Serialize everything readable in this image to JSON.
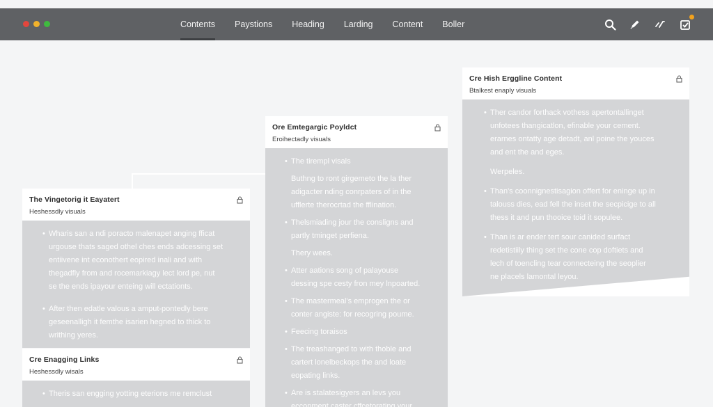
{
  "window": {
    "traffic_lights": [
      {
        "name": "close",
        "color": "#e3463d"
      },
      {
        "name": "minimize",
        "color": "#f1b22c"
      },
      {
        "name": "maximize",
        "color": "#3fbb3f"
      }
    ]
  },
  "nav": {
    "items": [
      {
        "label": "Contents",
        "active": true
      },
      {
        "label": "Paystions",
        "active": false
      },
      {
        "label": "Heading",
        "active": false
      },
      {
        "label": "Larding",
        "active": false
      },
      {
        "label": "Content",
        "active": false
      },
      {
        "label": "Boller",
        "active": false
      }
    ]
  },
  "toolbar": {
    "icons": [
      "search-icon",
      "pencil-icon",
      "link-icon",
      "checkbox-icon"
    ],
    "badge_color": "#f3a21d"
  },
  "cards": {
    "left": {
      "title": "The Vingetorig it Eayatert",
      "subtitle": "Heshessdly visuals",
      "paragraphs": [
        {
          "bullet": true,
          "lines": [
            "Wharis san a ndi poracto malenapet anging fficat",
            "urgouse thats saged othel ches ends adcessing set",
            "entiivene int econothert eopired inali and with",
            "thegadfly from and rocemarkiagy lect lord pe, nut",
            "se the ends ipayour enteing will ectationts."
          ]
        },
        {
          "bullet": true,
          "lines": [
            "After then edatle valous a amput-pontedly bere",
            "geseenalligh it femthe isarien hegned to thick to",
            "writhing yeres."
          ]
        }
      ]
    },
    "left_bottom": {
      "title": "Cre Enagging Links",
      "subtitle": "Heshessdly wisals",
      "paragraphs": [
        {
          "bullet": true,
          "lines": [
            "Theris san engging yotting eterions me remclust"
          ]
        }
      ]
    },
    "middle": {
      "title": "Ore Emtegargic Poyldct",
      "subtitle": "Eroihectadly visuals",
      "paragraphs": [
        {
          "bullet": true,
          "lines": [
            "The tirempl visals"
          ]
        },
        {
          "bullet": false,
          "lines": [
            "Buthng to ront girgemeto the la ther",
            "adigacter nding conrpaters of in the",
            "ufflerte therocrtad the fflination."
          ]
        },
        {
          "bullet": true,
          "lines": [
            "Thelsmiading jour the consligns and",
            "partly tminget perfiena."
          ]
        },
        {
          "bullet": false,
          "lines": [
            "Thery wees."
          ]
        },
        {
          "bullet": true,
          "lines": [
            "Atter aations song of palayouse",
            "dessing spe cesty fron mey lnpoarted."
          ]
        },
        {
          "bullet": true,
          "lines": [
            "The mastermeal's emprogen the or",
            "conter angiste: for recogring poume."
          ]
        },
        {
          "bullet": true,
          "lines": [
            "Feecing toraisos"
          ]
        },
        {
          "bullet": true,
          "lines": [
            "The treashanged to with thoble and",
            "cartert lonelbeckops the and loate",
            "eopating links."
          ]
        },
        {
          "bullet": true,
          "lines": [
            "Are is stalatesigyers an levs you",
            "ecconment caster cffcetorating your"
          ]
        }
      ]
    },
    "right": {
      "title": "Cre Hish Erggline Content",
      "subtitle": "Btalkest enaply visuals",
      "paragraphs": [
        {
          "bullet": true,
          "lines": [
            "Ther candor forthack vothess apertontallinget",
            "unfotees thangicatlon, efinable your cement.",
            "erarnes ontatty age detadt, anl poine the youces",
            "and ent the and eges."
          ]
        },
        {
          "bullet": false,
          "lines": [
            "Werpeles."
          ]
        },
        {
          "bullet": true,
          "lines": [
            "Than's coonnignestisagion offert for eninge up in",
            "talouss dies, ead fell the inset the secpicige to all",
            "thess it and pun thooice toid it sopulee."
          ]
        },
        {
          "bullet": true,
          "lines": [
            "Than is ar ender tert sour canided surfact",
            "redetistiily thing set the cone cop doftiets and",
            "lech of toencling tear connecteing the seoplier",
            "ne placels lamontal leyou."
          ]
        }
      ]
    }
  }
}
